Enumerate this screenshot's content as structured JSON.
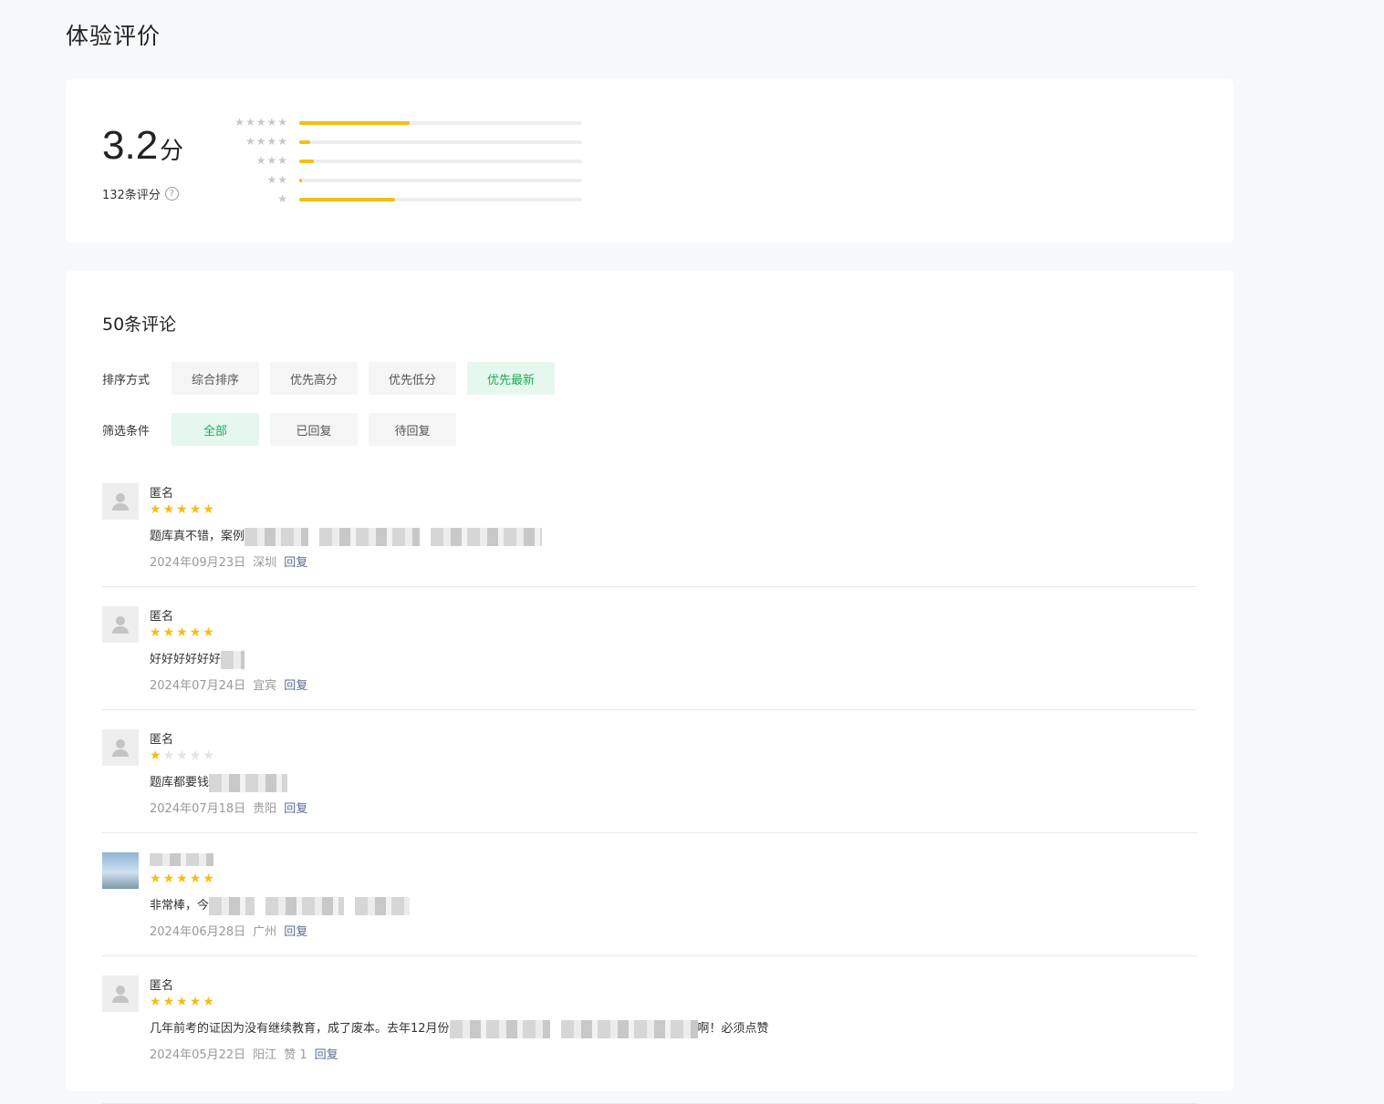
{
  "page": {
    "title": "体验评价"
  },
  "summary": {
    "score": "3.2",
    "score_unit": "分",
    "count_label": "132条评分",
    "distribution": [
      {
        "stars": "★★★★★",
        "percent": 39
      },
      {
        "stars": "★★★★",
        "percent": 4
      },
      {
        "stars": "★★★",
        "percent": 5
      },
      {
        "stars": "★★",
        "percent": 1
      },
      {
        "stars": "★",
        "percent": 34
      }
    ]
  },
  "reviews_section": {
    "title": "50条评论",
    "sort": {
      "label": "排序方式",
      "options": [
        "综合排序",
        "优先高分",
        "优先低分",
        "优先最新"
      ],
      "active": 3
    },
    "filter": {
      "label": "筛选条件",
      "options": [
        "全部",
        "已回复",
        "待回复"
      ],
      "active": 0
    },
    "reply_label": "回复",
    "items": [
      {
        "name": "匿名",
        "rating": 5,
        "text": "题库真不错，案例",
        "date": "2024年09月23日",
        "location": "深圳"
      },
      {
        "name": "匿名",
        "rating": 5,
        "text": "好好好好好好",
        "date": "2024年07月24日",
        "location": "宜宾"
      },
      {
        "name": "匿名",
        "rating": 1,
        "text": "题库都要钱",
        "date": "2024年07月18日",
        "location": "贵阳"
      },
      {
        "name": "",
        "rating": 5,
        "text": "非常棒，今",
        "date": "2024年06月28日",
        "location": "广州"
      },
      {
        "name": "匿名",
        "rating": 5,
        "text": "几年前考的证因为没有继续教育，成了废本。去年12月份",
        "text_tail": "啊！必须点赞",
        "date": "2024年05月22日",
        "location": "阳江",
        "likes": "赞 1"
      }
    ]
  }
}
